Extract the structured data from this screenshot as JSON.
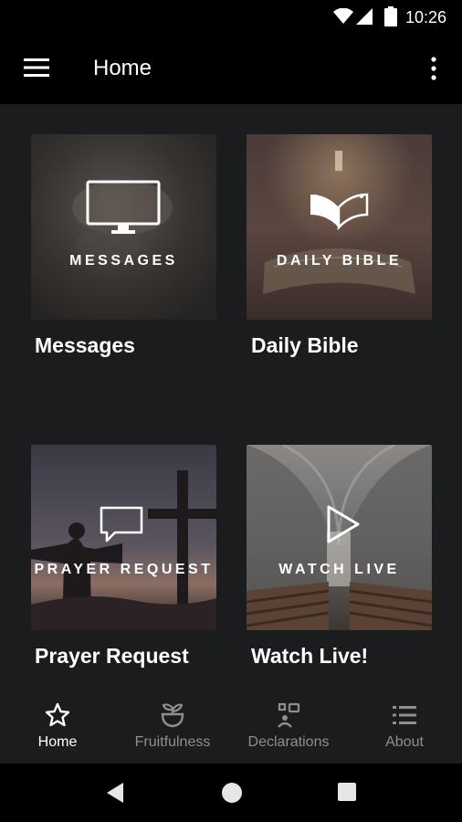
{
  "status_bar": {
    "time": "10:26",
    "icons": [
      "wifi-icon",
      "cell-signal-icon",
      "battery-icon"
    ]
  },
  "app_bar": {
    "title": "Home",
    "icons": [
      "menu-icon",
      "more-vert-icon"
    ]
  },
  "tiles": [
    {
      "overlay": "MESSAGES",
      "title": "Messages",
      "icon": "monitor-icon"
    },
    {
      "overlay": "DAILY BIBLE",
      "title": "Daily Bible",
      "icon": "open-book-icon"
    },
    {
      "overlay": "PRAYER REQUEST",
      "title": "Prayer Request",
      "icon": "chat-bubble-icon"
    },
    {
      "overlay": "WATCH LIVE",
      "title": "Watch Live!",
      "icon": "play-icon"
    }
  ],
  "bottom_nav": {
    "items": [
      {
        "label": "Home",
        "icon": "star-icon",
        "active": true
      },
      {
        "label": "Fruitfulness",
        "icon": "plant-icon",
        "active": false
      },
      {
        "label": "Declarations",
        "icon": "speaker-icon",
        "active": false
      },
      {
        "label": "About",
        "icon": "list-icon",
        "active": false
      }
    ]
  },
  "colors": {
    "background": "#1b1c1e",
    "bar": "#000000",
    "active": "#ffffff",
    "inactive": "#8f8f8f"
  }
}
